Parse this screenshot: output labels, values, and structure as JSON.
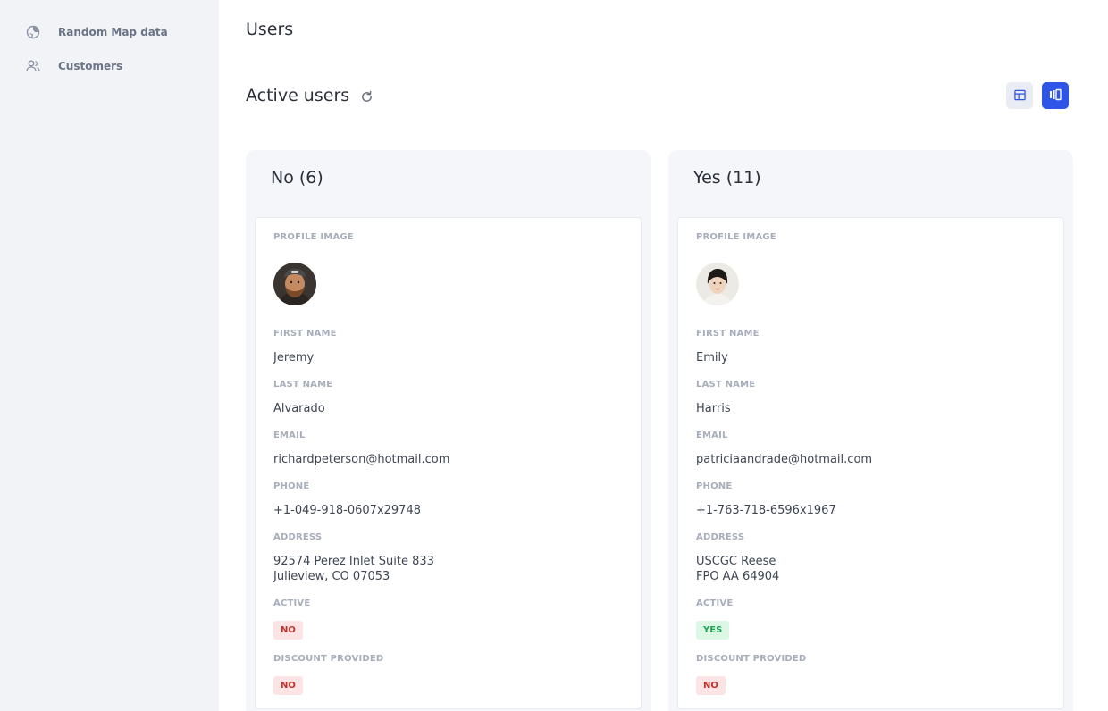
{
  "sidebar": {
    "items": [
      {
        "label": "Random Map data",
        "icon": "globe-icon"
      },
      {
        "label": "Customers",
        "icon": "users-icon"
      }
    ]
  },
  "header": {
    "title": "Users",
    "section_title": "Active users",
    "view_modes": [
      {
        "name": "table-view",
        "icon": "table-icon",
        "active": false
      },
      {
        "name": "board-view",
        "icon": "board-icon",
        "active": true
      }
    ]
  },
  "labels": {
    "profile_image": "PROFILE IMAGE",
    "first_name": "FIRST NAME",
    "last_name": "LAST NAME",
    "email": "EMAIL",
    "phone": "PHONE",
    "address": "ADDRESS",
    "active": "ACTIVE",
    "discount": "DISCOUNT PROVIDED"
  },
  "columns": [
    {
      "title": "No (6)",
      "card": {
        "first_name": "Jeremy",
        "last_name": "Alvarado",
        "email": "richardpeterson@hotmail.com",
        "phone": "+1-049-918-0607x29748",
        "address_line1": "92574 Perez Inlet Suite 833",
        "address_line2": "Julieview, CO 07053",
        "active": "NO",
        "discount": "NO"
      }
    },
    {
      "title": "Yes (11)",
      "card": {
        "first_name": "Emily",
        "last_name": "Harris",
        "email": "patriciaandrade@hotmail.com",
        "phone": "+1-763-718-6596x1967",
        "address_line1": "USCGC Reese",
        "address_line2": "FPO AA 64904",
        "active": "YES",
        "discount": "NO"
      }
    }
  ],
  "colors": {
    "accent": "#2f55e8",
    "badge_no_bg": "#fde4e4",
    "badge_no_text": "#c0332f",
    "badge_yes_bg": "#dcf7e6",
    "badge_yes_text": "#24a354"
  }
}
